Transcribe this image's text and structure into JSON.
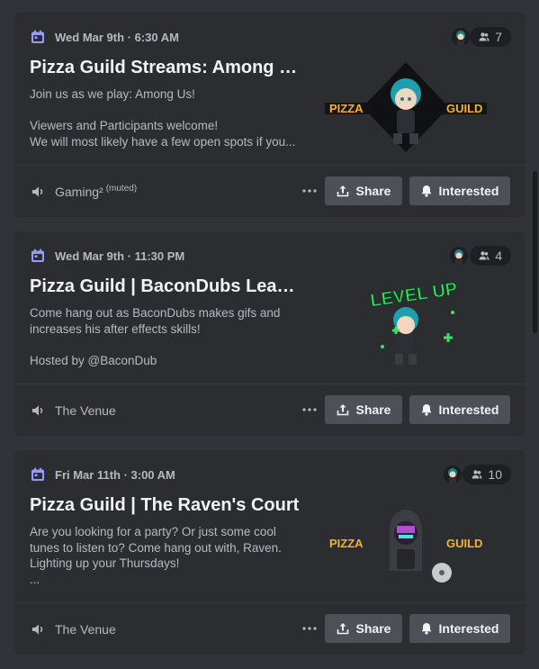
{
  "events": [
    {
      "date": "Wed Mar 9th · 6:30 AM",
      "title": "Pizza Guild Streams: Among Us",
      "description": [
        "Join us as we play: Among Us!",
        "",
        "Viewers and Participants welcome!",
        "We will most likely have a few open spots if you..."
      ],
      "interested_count": "7",
      "channel": "Gaming²",
      "channel_suffix": "(muted)",
      "art": "pizza-guild-banner",
      "art_text_left": "PIZZA",
      "art_text_right": "GUILD"
    },
    {
      "date": "Wed Mar 9th · 11:30 PM",
      "title": "Pizza Guild | BaconDubs Learns After Effects",
      "description": [
        "Come hang out as BaconDubs makes gifs and increases his after effects skills!",
        "",
        "Hosted by @BaconDub"
      ],
      "interested_count": "4",
      "channel": "The Venue",
      "channel_suffix": "",
      "art": "level-up-banner",
      "art_text_left": "LEVEL UP",
      "art_text_right": ""
    },
    {
      "date": "Fri Mar 11th · 3:00 AM",
      "title": "Pizza Guild | The Raven's Court",
      "description": [
        "Are you looking for a party? Or just some cool tunes to listen to? Come hang out with, Raven. Lighting up your Thursdays!",
        "..."
      ],
      "interested_count": "10",
      "channel": "The Venue",
      "channel_suffix": "",
      "art": "raven-banner",
      "art_text_left": "PIZZA",
      "art_text_right": "GUILD"
    }
  ],
  "labels": {
    "share": "Share",
    "interested": "Interested"
  },
  "icons": {
    "calendar": "calendar-icon",
    "people": "people-icon",
    "speaker": "speaker-icon",
    "more": "more-dots-icon",
    "share": "share-icon",
    "bell": "bell-icon"
  },
  "colors": {
    "background": "#313338",
    "card": "#2b2d31",
    "button": "#4e5058",
    "calendar_accent": "#949cf7",
    "pizza_text": "#f0b232",
    "levelup_green": "#3ee06a"
  }
}
